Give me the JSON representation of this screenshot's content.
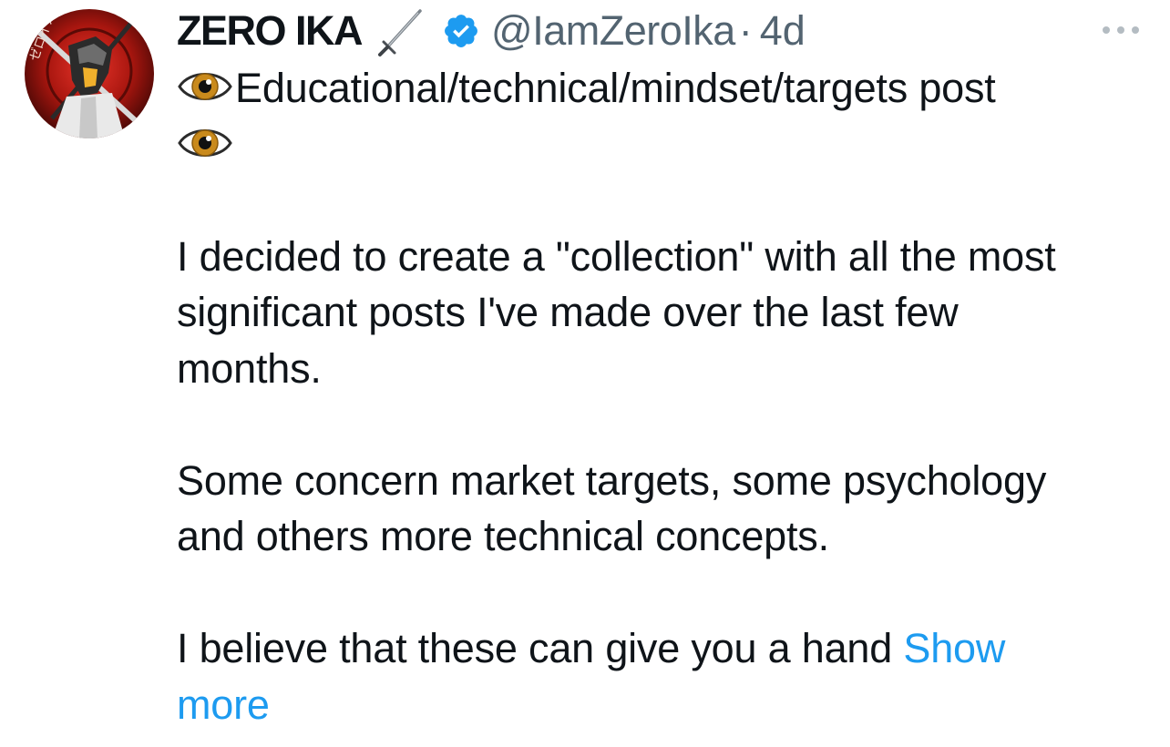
{
  "tweet": {
    "display_name": "ZERO IKA",
    "handle": "@IamZeroIka",
    "separator": "·",
    "time": "4d",
    "name_emoji_icon": "dagger-icon",
    "verified_icon": "verified-badge-icon",
    "more_icon": "more-options-icon",
    "avatar_icon": "profile-avatar",
    "text": {
      "line1_emoji_icon": "eye-icon",
      "line1": "Educational/technical/mindset/targets post",
      "line2_emoji_icon": "eye-icon",
      "paragraph1_lines": [
        "I decided to create a \"collection\" with all the most",
        "significant posts I've made over the last few",
        "months."
      ],
      "paragraph2_lines": [
        "Some concern market targets, some psychology",
        "and others more technical concepts."
      ],
      "paragraph3_text": "I believe that these can give you a hand ",
      "show_more_line1": "Show",
      "show_more_line2": "more"
    },
    "colors": {
      "text": "#0f1419",
      "secondary": "#536471",
      "link": "#1d9bf0",
      "verified": "#1d9bf0"
    }
  }
}
